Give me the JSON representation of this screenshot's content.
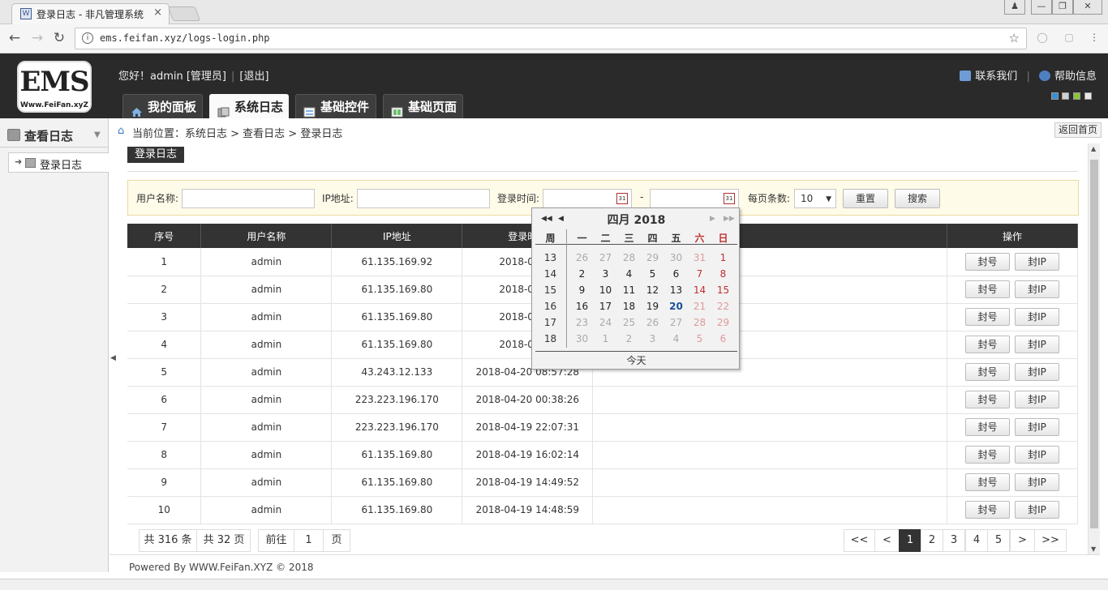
{
  "browser": {
    "tab_title": "登录日志 - 非凡管理系统",
    "tab_close": "×",
    "url": "ems.feifan.xyz/logs-login.php",
    "info_glyph": "i",
    "star_glyph": "☆"
  },
  "header": {
    "logo_text": "EMS",
    "logo_sub": "Www.FeiFan.xyZ",
    "greeting": "您好！admin [管理员]",
    "logout": "[退出]",
    "contact": "联系我们",
    "help": "帮助信息",
    "nav": [
      "我的面板",
      "系统日志",
      "基础控件",
      "基础页面"
    ],
    "theme_colors": [
      "#3b8fd0",
      "#cfcfcf",
      "#8ac23a",
      "#e8e8e8"
    ]
  },
  "sidebar": {
    "title": "查看日志",
    "item": "登录日志"
  },
  "breadcrumb": {
    "prefix": "当前位置：",
    "path": "系统日志 > 查看日志 > 登录日志",
    "back": "返回首页"
  },
  "section_title": "登录日志",
  "filter": {
    "username_label": "用户名称:",
    "ip_label": "IP地址:",
    "time_label": "登录时间:",
    "dash": "-",
    "pagesize_label": "每页条数:",
    "pagesize_value": "10",
    "reset": "重置",
    "search": "搜索",
    "cal_glyph": "31"
  },
  "table": {
    "columns": [
      "序号",
      "用户名称",
      "IP地址",
      "登录时间",
      "",
      "操作"
    ],
    "ban_user": "封号",
    "ban_ip": "封IP",
    "rows": [
      [
        "1",
        "admin",
        "61.135.169.92",
        "2018-04-20"
      ],
      [
        "2",
        "admin",
        "61.135.169.80",
        "2018-04-20"
      ],
      [
        "3",
        "admin",
        "61.135.169.80",
        "2018-04-20"
      ],
      [
        "4",
        "admin",
        "61.135.169.80",
        "2018-04-20"
      ],
      [
        "5",
        "admin",
        "43.243.12.133",
        "2018-04-20 08:57:28"
      ],
      [
        "6",
        "admin",
        "223.223.196.170",
        "2018-04-20 00:38:26"
      ],
      [
        "7",
        "admin",
        "223.223.196.170",
        "2018-04-19 22:07:31"
      ],
      [
        "8",
        "admin",
        "61.135.169.80",
        "2018-04-19 16:02:14"
      ],
      [
        "9",
        "admin",
        "61.135.169.80",
        "2018-04-19 14:49:52"
      ],
      [
        "10",
        "admin",
        "61.135.169.80",
        "2018-04-19 14:48:59"
      ]
    ]
  },
  "pager": {
    "total_records": "共 316 条",
    "total_pages": "共 32 页",
    "goto": "前往",
    "page_input": "1",
    "page_unit": "页",
    "first": "<<",
    "prev": "<",
    "pages": [
      "1",
      "2",
      "3",
      "4",
      "5"
    ],
    "current": "1",
    "next": ">",
    "last": ">>"
  },
  "footer": "Powered By WWW.FeiFan.XYZ © 2018",
  "calendar": {
    "title": "四月 2018",
    "week_col": "周",
    "weekdays": [
      "一",
      "二",
      "三",
      "四",
      "五",
      "六",
      "日"
    ],
    "today_button": "今天",
    "selected_day": "20",
    "weeks": [
      {
        "no": "13",
        "days": [
          [
            "26",
            "o"
          ],
          [
            "27",
            "o"
          ],
          [
            "28",
            "o"
          ],
          [
            "29",
            "o"
          ],
          [
            "30",
            "o"
          ],
          [
            "31",
            "ow"
          ],
          [
            "1",
            "w"
          ]
        ]
      },
      {
        "no": "14",
        "days": [
          [
            "2",
            ""
          ],
          [
            "3",
            ""
          ],
          [
            "4",
            ""
          ],
          [
            "5",
            ""
          ],
          [
            "6",
            ""
          ],
          [
            "7",
            "w"
          ],
          [
            "8",
            "w"
          ]
        ]
      },
      {
        "no": "15",
        "days": [
          [
            "9",
            ""
          ],
          [
            "10",
            ""
          ],
          [
            "11",
            ""
          ],
          [
            "12",
            ""
          ],
          [
            "13",
            ""
          ],
          [
            "14",
            "w"
          ],
          [
            "15",
            "w"
          ]
        ]
      },
      {
        "no": "16",
        "days": [
          [
            "16",
            ""
          ],
          [
            "17",
            ""
          ],
          [
            "18",
            ""
          ],
          [
            "19",
            ""
          ],
          [
            "20",
            "t"
          ],
          [
            "21",
            "ow"
          ],
          [
            "22",
            "ow"
          ]
        ]
      },
      {
        "no": "17",
        "days": [
          [
            "23",
            "o"
          ],
          [
            "24",
            "o"
          ],
          [
            "25",
            "o"
          ],
          [
            "26",
            "o"
          ],
          [
            "27",
            "o"
          ],
          [
            "28",
            "ow"
          ],
          [
            "29",
            "ow"
          ]
        ]
      },
      {
        "no": "18",
        "days": [
          [
            "30",
            "o"
          ],
          [
            "1",
            "o"
          ],
          [
            "2",
            "o"
          ],
          [
            "3",
            "o"
          ],
          [
            "4",
            "o"
          ],
          [
            "5",
            "ow"
          ],
          [
            "6",
            "ow"
          ]
        ]
      }
    ]
  }
}
